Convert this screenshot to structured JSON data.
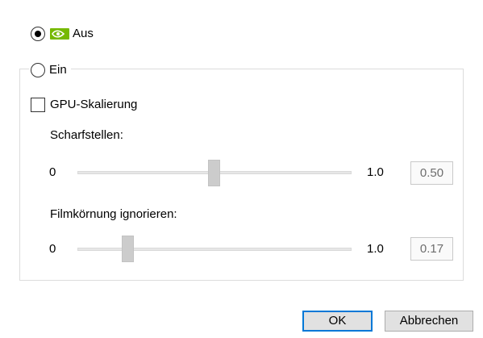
{
  "mode": {
    "off_label": "Aus",
    "off_selected": true,
    "on_label": "Ein",
    "on_selected": false
  },
  "gpu_scaling": {
    "label": "GPU-Skalierung",
    "checked": false
  },
  "sliders": [
    {
      "label": "Scharfstellen:",
      "min": "0",
      "max": "1.0",
      "value": "0.50",
      "fraction": 0.5
    },
    {
      "label": "Filmkörnung ignorieren:",
      "min": "0",
      "max": "1.0",
      "value": "0.17",
      "fraction": 0.17
    }
  ],
  "buttons": {
    "ok_label": "OK",
    "cancel_label": "Abbrechen"
  },
  "icons": {
    "nvidia": "nvidia-logo-icon"
  },
  "colors": {
    "nvidia_green": "#76b900",
    "accent": "#0078d7"
  }
}
